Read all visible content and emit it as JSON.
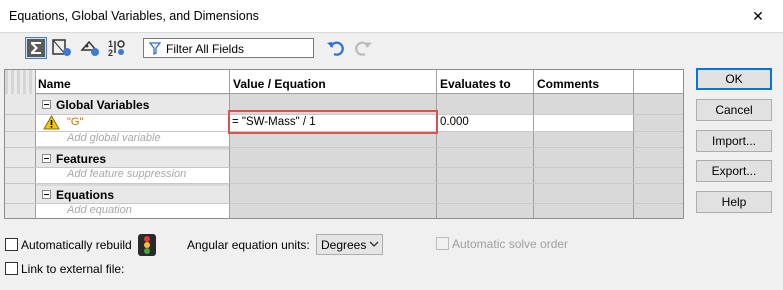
{
  "window": {
    "title": "Equations, Global Variables, and Dimensions",
    "close_glyph": "✕"
  },
  "toolbar": {
    "buttons": [
      {
        "icon": "sigma-equation-view-icon",
        "active": true
      },
      {
        "icon": "sketch-equation-view-icon",
        "active": false
      },
      {
        "icon": "dimension-view-icon",
        "active": false
      },
      {
        "icon": "ordered-view-icon",
        "active": false
      }
    ],
    "filter_placeholder": "Filter All Fields",
    "undo_icon": "undo-icon",
    "redo_icon": "redo-icon"
  },
  "grid": {
    "columns": [
      "Name",
      "Value / Equation",
      "Evaluates to",
      "Comments"
    ],
    "groups": [
      {
        "label": "Global Variables",
        "rows": [
          {
            "warning": true,
            "name": "\"G\"",
            "value": "= \"SW-Mass\" / 1",
            "evaluates": "0.000",
            "comment": ""
          }
        ],
        "add_placeholder": "Add global variable"
      },
      {
        "label": "Features",
        "rows": [],
        "add_placeholder": "Add feature suppression"
      },
      {
        "label": "Equations",
        "rows": [],
        "add_placeholder": "Add equation"
      }
    ]
  },
  "side_buttons": {
    "ok": "OK",
    "cancel": "Cancel",
    "import": "Import...",
    "export": "Export...",
    "help": "Help"
  },
  "bottom": {
    "auto_rebuild_label": "Automatically rebuild",
    "auto_rebuild_checked": false,
    "link_external_label": "Link to external file:",
    "link_external_checked": false,
    "angular_units_label": "Angular equation units:",
    "angular_units_value": "Degrees",
    "auto_solve_label": "Automatic solve order",
    "auto_solve_checked": false,
    "auto_solve_enabled": false
  },
  "colors": {
    "highlight": "#d9534f",
    "accent": "#0078d7",
    "warning": "#f5c518"
  }
}
